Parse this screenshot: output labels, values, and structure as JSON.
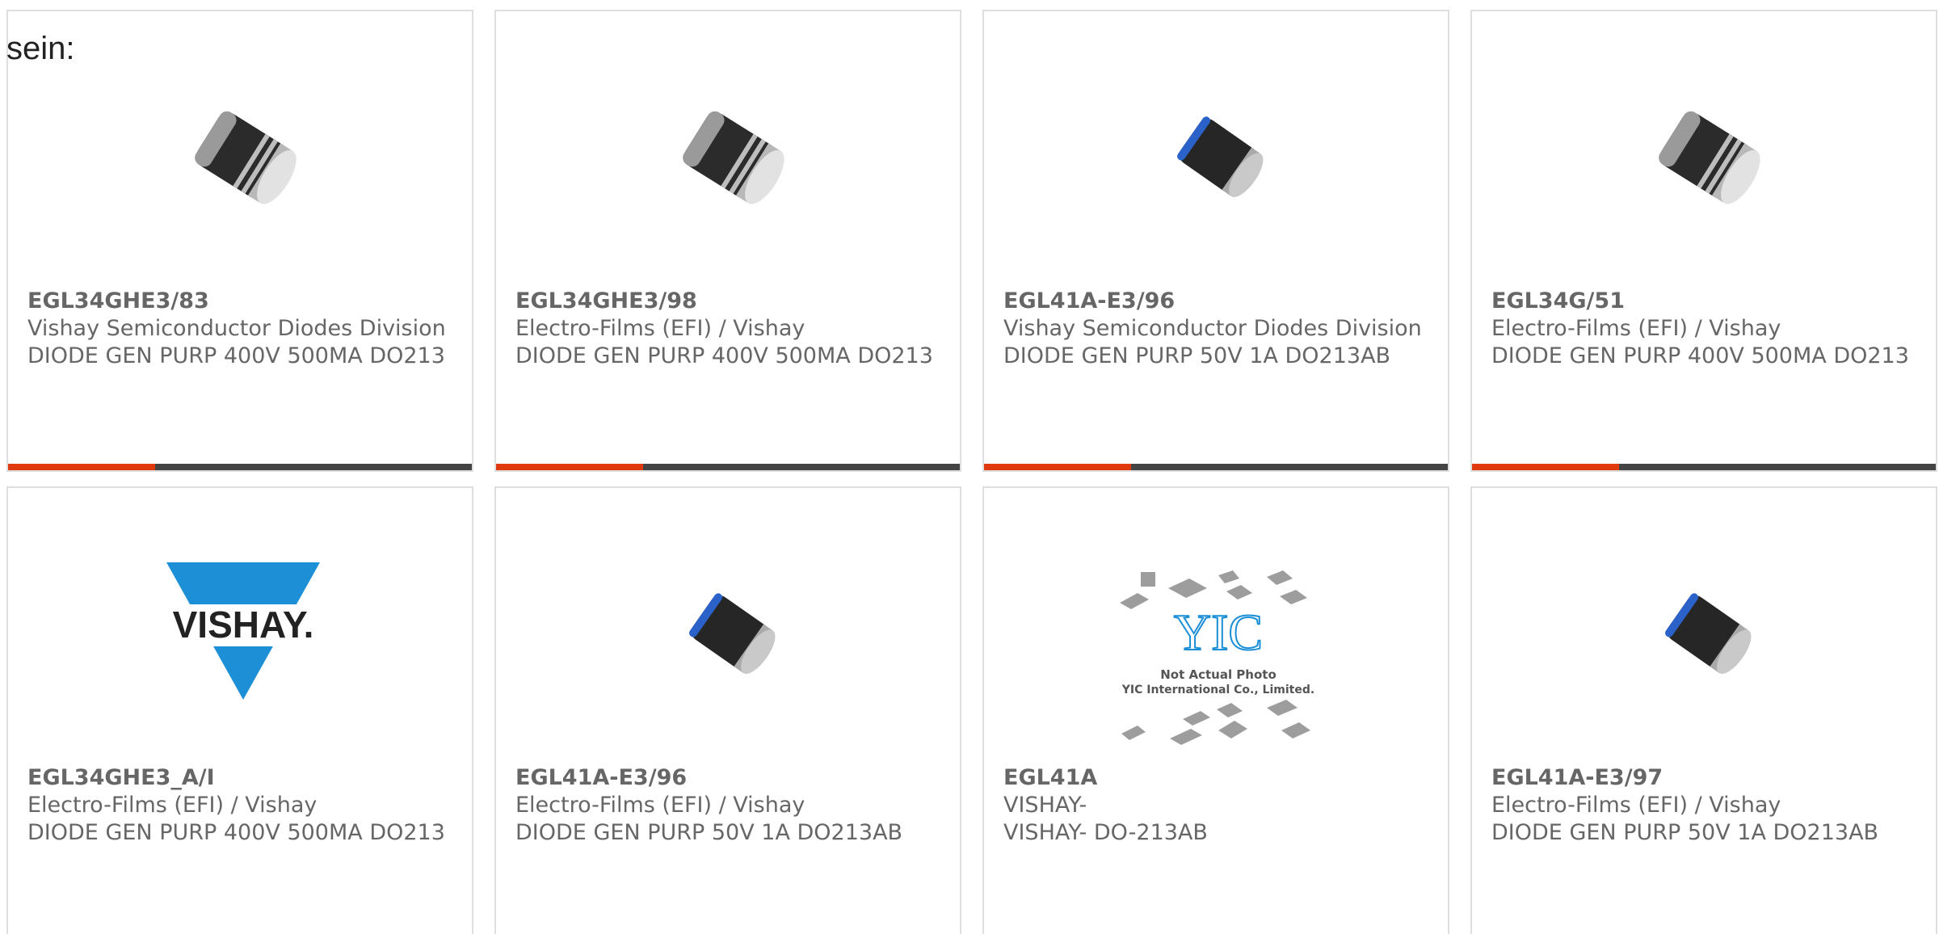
{
  "intro_text": "sein:",
  "colors": {
    "accent": "#e03a0f",
    "bar": "#444444",
    "border": "#dedede",
    "text": "#666666",
    "vishay_blue": "#1c8fd6"
  },
  "cards": [
    {
      "part": "EGL34GHE3/83",
      "mfr": "Vishay Semiconductor Diodes Division",
      "desc": "DIODE GEN PURP 400V 500MA DO213",
      "image": "diode-banded-icon"
    },
    {
      "part": "EGL34GHE3/98",
      "mfr": "Electro-Films (EFI) / Vishay",
      "desc": "DIODE GEN PURP 400V 500MA DO213",
      "image": "diode-banded-icon"
    },
    {
      "part": "EGL41A-E3/96",
      "mfr": "Vishay Semiconductor Diodes Division",
      "desc": "DIODE GEN PURP 50V 1A DO213AB",
      "image": "diode-blue-band-icon"
    },
    {
      "part": "EGL34G/51",
      "mfr": "Electro-Films (EFI) / Vishay",
      "desc": "DIODE GEN PURP 400V 500MA DO213",
      "image": "diode-banded-icon"
    },
    {
      "part": "EGL34GHE3_A/I",
      "mfr": "Electro-Films (EFI) / Vishay",
      "desc": "DIODE GEN PURP 400V 500MA DO213",
      "image": "vishay-logo",
      "logo_text": "VISHAY."
    },
    {
      "part": "EGL41A-E3/96",
      "mfr": "Electro-Films (EFI) / Vishay",
      "desc": "DIODE GEN PURP 50V 1A DO213AB",
      "image": "diode-blue-band-icon"
    },
    {
      "part": "EGL41A",
      "mfr": "VISHAY-",
      "desc": "VISHAY- DO-213AB",
      "image": "yic-placeholder",
      "placeholder_line1": "Not Actual Photo",
      "placeholder_line2": "YIC International Co., Limited."
    },
    {
      "part": "EGL41A-E3/97",
      "mfr": "Electro-Films (EFI) / Vishay",
      "desc": "DIODE GEN PURP 50V 1A DO213AB",
      "image": "diode-blue-band-icon"
    }
  ]
}
